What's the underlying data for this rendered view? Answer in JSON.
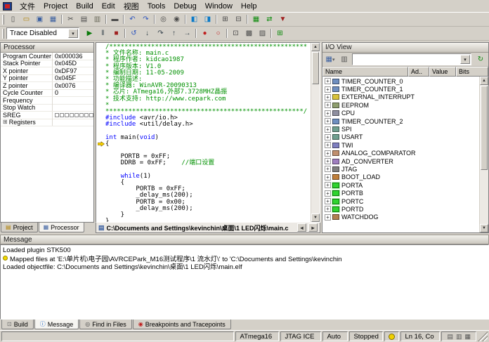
{
  "app": {
    "name": "AVR Studio"
  },
  "menu": {
    "items": [
      "文件",
      "Project",
      "Build",
      "Edit",
      "视图",
      "Tools",
      "Debug",
      "Window",
      "Help"
    ]
  },
  "toolbar": {
    "trace_combo": "Trace Disabled",
    "row1": [
      {
        "n": "new-file",
        "g": "▯",
        "c": "#4a4a4a"
      },
      {
        "n": "open-file",
        "g": "▭",
        "c": "#b08000"
      },
      {
        "n": "save",
        "g": "▣",
        "c": "#3a5fa0"
      },
      {
        "n": "save-all",
        "g": "▦",
        "c": "#3a5fa0"
      },
      {
        "sep": 1
      },
      {
        "n": "cut",
        "g": "✂",
        "c": "#4a4a4a"
      },
      {
        "n": "copy",
        "g": "▤",
        "c": "#4a4a4a"
      },
      {
        "n": "paste",
        "g": "▥",
        "c": "#6a6a5a"
      },
      {
        "sep": 1
      },
      {
        "n": "print",
        "g": "▬",
        "c": "#4a4a4a"
      },
      {
        "sep": 1
      },
      {
        "n": "undo",
        "g": "↶",
        "c": "#2a52be"
      },
      {
        "n": "redo",
        "g": "↷",
        "c": "#2a52be"
      },
      {
        "sep": 1
      },
      {
        "n": "find",
        "g": "◎",
        "c": "#4a4a4a"
      },
      {
        "n": "find-in-files",
        "g": "◉",
        "c": "#4a4a4a"
      },
      {
        "sep": 1
      },
      {
        "n": "toggle-bookmark",
        "g": "◧",
        "c": "#0a7ac8"
      },
      {
        "n": "next-bookmark",
        "g": "◨",
        "c": "#0a7ac8"
      },
      {
        "sep": 1
      },
      {
        "n": "new-project",
        "g": "⊞",
        "c": "#4a4a4a"
      },
      {
        "n": "open-project",
        "g": "⊟",
        "c": "#4a4a4a"
      },
      {
        "sep": 1
      },
      {
        "n": "device-programming",
        "g": "▦",
        "c": "#0a8a0a"
      },
      {
        "n": "connect",
        "g": "⇄",
        "c": "#0a8a0a"
      },
      {
        "n": "simulator-options",
        "g": "▼",
        "c": "#a02020"
      }
    ],
    "row2": [
      {
        "n": "run",
        "g": "▶",
        "c": "#0a7a0a"
      },
      {
        "n": "pause",
        "g": "‖",
        "c": "#33404a"
      },
      {
        "n": "stop-debugging",
        "g": "■",
        "c": "#a02020"
      },
      {
        "sep": 1
      },
      {
        "n": "reset",
        "g": "↺",
        "c": "#2a52be"
      },
      {
        "n": "step-into",
        "g": "↓",
        "c": "#33404a"
      },
      {
        "n": "step-over",
        "g": "↷",
        "c": "#33404a"
      },
      {
        "n": "step-out",
        "g": "↑",
        "c": "#33404a"
      },
      {
        "n": "run-to-cursor",
        "g": "→",
        "c": "#33404a"
      },
      {
        "sep": 1
      },
      {
        "n": "toggle-breakpoint",
        "g": "●",
        "c": "#c02020"
      },
      {
        "n": "remove-breakpoints",
        "g": "○",
        "c": "#c02020"
      },
      {
        "sep": 1
      },
      {
        "n": "quickwatch",
        "g": "⊡",
        "c": "#4a4a4a"
      },
      {
        "n": "memory-view",
        "g": "▩",
        "c": "#4a4a4a"
      },
      {
        "n": "disassembler",
        "g": "▨",
        "c": "#4a4a4a"
      },
      {
        "sep": 1
      },
      {
        "n": "io-view-toggle",
        "g": "⊞",
        "c": "#0a8a0a"
      }
    ]
  },
  "processor": {
    "title": "Processor",
    "rows": [
      {
        "name": "Program Counter",
        "value": "0x000036"
      },
      {
        "name": "Stack Pointer",
        "value": "0x045D"
      },
      {
        "name": "X pointer",
        "value": "0xDF97"
      },
      {
        "name": "Y pointer",
        "value": "0x045F"
      },
      {
        "name": "Z pointer",
        "value": "0x0076"
      },
      {
        "name": "Cycle Counter",
        "value": "0"
      },
      {
        "name": "Frequency",
        "value": ""
      },
      {
        "name": "Stop Watch",
        "value": ""
      },
      {
        "name": "SREG",
        "value": "",
        "sreg": 1
      },
      {
        "name": "Registers",
        "value": "",
        "expander": 1
      }
    ]
  },
  "left_tabs": [
    {
      "label": "Project",
      "g": "▤",
      "c": "#b08000"
    },
    {
      "label": "Processor",
      "g": "▦",
      "c": "#3a5fa0",
      "active": 1
    }
  ],
  "editor": {
    "path": "C:\\Documents and Settings\\kevinchin\\桌面\\1 LED闪烁\\main.c",
    "lines": [
      {
        "s": [
          [
            "/****************************************************",
            "com"
          ]
        ]
      },
      {
        "s": [
          [
            "* 文件名称: main.c",
            "com"
          ]
        ]
      },
      {
        "s": [
          [
            "* 程序作者: kidcao1987",
            "com"
          ]
        ]
      },
      {
        "s": [
          [
            "* 程序版本: V1.0",
            "com"
          ]
        ]
      },
      {
        "s": [
          [
            "* 编制日期: 11-05-2009",
            "com"
          ]
        ]
      },
      {
        "s": [
          [
            "* 功能描述:",
            "com"
          ]
        ]
      },
      {
        "s": [
          [
            "* 编译器: WinAVR-20090313",
            "com"
          ]
        ]
      },
      {
        "s": [
          [
            "* 芯片: ATmega16,外部7.3728MHZ晶振",
            "com"
          ]
        ]
      },
      {
        "s": [
          [
            "* 技术支持: http://www.cepark.com",
            "com"
          ]
        ]
      },
      {
        "s": [
          [
            "*",
            "com"
          ]
        ]
      },
      {
        "s": [
          [
            "****************************************************/",
            "com"
          ]
        ]
      },
      {
        "s": [
          [
            "#include",
            "kw"
          ],
          [
            " <avr/io.h>",
            ""
          ]
        ]
      },
      {
        "s": [
          [
            "#include",
            "kw"
          ],
          [
            " <util/delay.h>",
            ""
          ]
        ]
      },
      {
        "s": []
      },
      {
        "s": [
          [
            "int",
            "kw"
          ],
          [
            " main(",
            ""
          ],
          [
            "void",
            "kw"
          ],
          [
            ")",
            ""
          ]
        ]
      },
      {
        "a": 1,
        "s": [
          [
            "{",
            ""
          ]
        ]
      },
      {
        "s": []
      },
      {
        "s": [
          [
            "    PORTB = 0xFF;",
            ""
          ]
        ]
      },
      {
        "s": [
          [
            "    DDRB = 0xFF;    ",
            ""
          ],
          [
            "//端口设置",
            "com"
          ]
        ]
      },
      {
        "s": []
      },
      {
        "s": [
          [
            "    ",
            ""
          ],
          [
            "while",
            "kw"
          ],
          [
            "(1)",
            ""
          ]
        ]
      },
      {
        "s": [
          [
            "    {",
            ""
          ]
        ]
      },
      {
        "s": [
          [
            "        PORTB = 0xFF;",
            ""
          ]
        ]
      },
      {
        "s": [
          [
            "        _delay_ms(200);",
            ""
          ]
        ]
      },
      {
        "s": [
          [
            "        PORTB = 0x00;",
            ""
          ]
        ]
      },
      {
        "s": [
          [
            "        _delay_ms(200);",
            ""
          ]
        ]
      },
      {
        "s": [
          [
            "    }",
            ""
          ]
        ]
      },
      {
        "s": [
          [
            "}",
            ""
          ]
        ]
      }
    ]
  },
  "io_view": {
    "title": "I/O View",
    "columns": [
      "Name",
      "Ad..",
      "Value",
      "Bits"
    ],
    "rows": [
      {
        "name": "TIMER_COUNTER_0",
        "icon": "timer-counter-icon",
        "c": "#6f8fc0"
      },
      {
        "name": "TIMER_COUNTER_1",
        "icon": "timer-counter-icon",
        "c": "#6f8fc0"
      },
      {
        "name": "EXTERNAL_INTERRUPT",
        "icon": "external-interrupt-icon",
        "c": "#d8c23a"
      },
      {
        "name": "EEPROM",
        "icon": "eeprom-icon",
        "c": "#8f9f6f"
      },
      {
        "name": "CPU",
        "icon": "cpu-icon",
        "c": "#8f8f9f"
      },
      {
        "name": "TIMER_COUNTER_2",
        "icon": "timer-counter-icon",
        "c": "#6f8fc0"
      },
      {
        "name": "SPI",
        "icon": "spi-icon",
        "c": "#6f9f8f"
      },
      {
        "name": "USART",
        "icon": "usart-icon",
        "c": "#6f9f8f"
      },
      {
        "name": "TWI",
        "icon": "twi-icon",
        "c": "#7f7fc0"
      },
      {
        "name": "ANALOG_COMPARATOR",
        "icon": "analog-comparator-icon",
        "c": "#c08f6f"
      },
      {
        "name": "AD_CONVERTER",
        "icon": "ad-converter-icon",
        "c": "#a07fc0"
      },
      {
        "name": "JTAG",
        "icon": "jtag-icon",
        "c": "#808080"
      },
      {
        "name": "BOOT_LOAD",
        "icon": "boot-load-icon",
        "c": "#c07f3a"
      },
      {
        "name": "PORTA",
        "icon": "port-icon",
        "c": "#2fd42f",
        "hl": 1
      },
      {
        "name": "PORTB",
        "icon": "port-icon",
        "c": "#2fd42f",
        "hl": 1
      },
      {
        "name": "PORTC",
        "icon": "port-icon",
        "c": "#2fd42f",
        "hl": 1
      },
      {
        "name": "PORTD",
        "icon": "port-icon",
        "c": "#2fd42f",
        "hl": 1
      },
      {
        "name": "WATCHDOG",
        "icon": "watchdog-icon",
        "c": "#b08050"
      }
    ]
  },
  "message": {
    "title": "Message",
    "lines": [
      {
        "text": "Loaded plugin STK500"
      },
      {
        "text": "Mapped files at 'E:\\单片机\\电子园\\AVRCEPark_M16测试程序\\1 流水灯\\' to 'C:\\Documents and Settings\\kevinchin",
        "bullet": 1
      },
      {
        "text": "Loaded objectfile: C:\\Documents and Settings\\kevinchin\\桌面\\1 LED闪烁\\main.elf"
      }
    ]
  },
  "output_tabs": [
    {
      "label": "Build",
      "g": "⊡",
      "c": "#6a6a6a"
    },
    {
      "label": "Message",
      "g": "ⓘ",
      "c": "#0a5ac8",
      "active": 1
    },
    {
      "label": "Find in Files",
      "g": "◎",
      "c": "#4a4a4a"
    },
    {
      "label": "Breakpoints and Tracepoints",
      "g": "◉",
      "c": "#c02020"
    }
  ],
  "status": {
    "device": "ATmega16",
    "platform": "JTAG ICE",
    "mode": "Auto",
    "state": "Stopped",
    "position": "Ln 16, Co",
    "indicators": [
      {
        "n": "keyboard-status-icon",
        "g": "▤"
      },
      {
        "n": "overwrite-status-icon",
        "g": "▥"
      },
      {
        "n": "macro-status-icon",
        "g": "▦"
      }
    ]
  }
}
